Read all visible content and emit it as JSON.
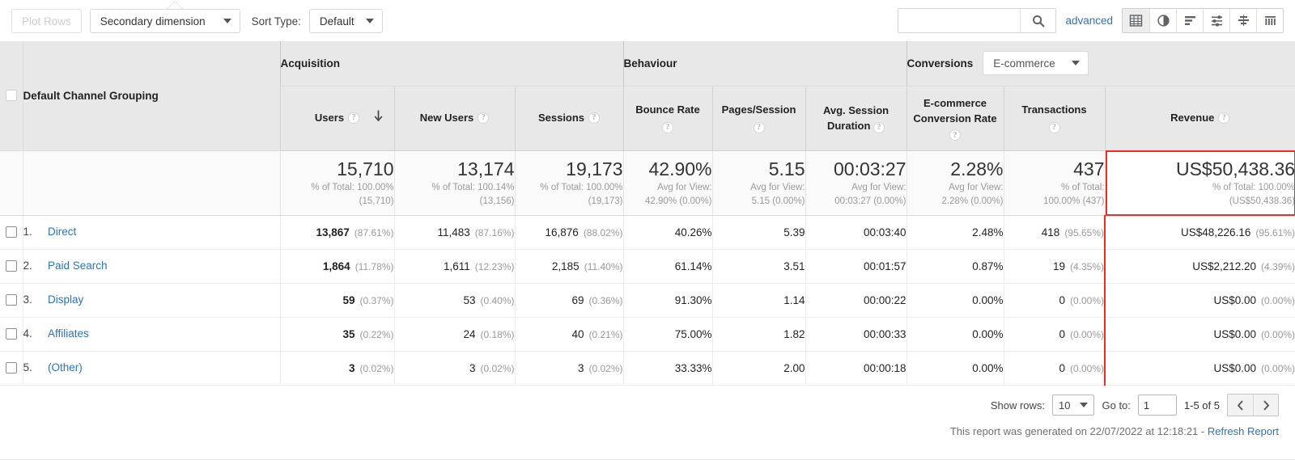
{
  "toolbar": {
    "plot_rows_label": "Plot Rows",
    "secondary_dimension_label": "Secondary dimension",
    "sort_type_label": "Sort Type:",
    "sort_type_value": "Default",
    "search_placeholder": "",
    "search_value": "",
    "search_icon": "search-icon",
    "advanced_label": "advanced",
    "view_buttons": [
      {
        "name": "table-view",
        "icon": "table-icon",
        "active": true
      },
      {
        "name": "pie-view",
        "icon": "pie-chart-icon",
        "active": false
      },
      {
        "name": "percentage-view",
        "icon": "bar-chart-icon",
        "active": false
      },
      {
        "name": "performance-view",
        "icon": "performance-icon",
        "active": false
      },
      {
        "name": "comparison-view",
        "icon": "comparison-icon",
        "active": false
      },
      {
        "name": "pivot-view",
        "icon": "pivot-icon",
        "active": false
      }
    ]
  },
  "table": {
    "dimension_header": "Default Channel Grouping",
    "groups": [
      {
        "label": "Acquisition"
      },
      {
        "label": "Behaviour"
      },
      {
        "label": "Conversions",
        "dropdown": "E-commerce"
      }
    ],
    "columns": [
      {
        "label": "Users",
        "help": "?",
        "sorted": "desc"
      },
      {
        "label": "New Users",
        "help": "?"
      },
      {
        "label": "Sessions",
        "help": "?"
      },
      {
        "label": "Bounce Rate",
        "help": "?"
      },
      {
        "label": "Pages/Session",
        "help": "?"
      },
      {
        "label": "Avg. Session Duration",
        "help": "?"
      },
      {
        "label": "E-commerce Conversion Rate",
        "help": "?"
      },
      {
        "label": "Transactions",
        "help": "?"
      },
      {
        "label": "Revenue",
        "help": "?"
      }
    ],
    "summary": [
      {
        "value": "15,710",
        "sub1": "% of Total: 100.00%",
        "sub2": "(15,710)"
      },
      {
        "value": "13,174",
        "sub1": "% of Total: 100.14%",
        "sub2": "(13,156)"
      },
      {
        "value": "19,173",
        "sub1": "% of Total: 100.00%",
        "sub2": "(19,173)"
      },
      {
        "value": "42.90%",
        "sub1": "Avg for View:",
        "sub2": "42.90% (0.00%)"
      },
      {
        "value": "5.15",
        "sub1": "Avg for View:",
        "sub2": "5.15 (0.00%)"
      },
      {
        "value": "00:03:27",
        "sub1": "Avg for View:",
        "sub2": "00:03:27 (0.00%)"
      },
      {
        "value": "2.28%",
        "sub1": "Avg for View:",
        "sub2": "2.28% (0.00%)"
      },
      {
        "value": "437",
        "sub1": "% of Total:",
        "sub2": "100.00% (437)"
      },
      {
        "value": "US$50,438.36",
        "sub1": "% of Total: 100.00%",
        "sub2": "(US$50,438.36)"
      }
    ],
    "rows": [
      {
        "index": "1.",
        "name": "Direct",
        "users": "13,867",
        "users_pct": "(87.61%)",
        "new_users": "11,483",
        "new_users_pct": "(87.16%)",
        "sessions": "16,876",
        "sessions_pct": "(88.02%)",
        "bounce_rate": "40.26%",
        "pages_session": "5.39",
        "avg_duration": "00:03:40",
        "ecom_rate": "2.48%",
        "transactions": "418",
        "transactions_pct": "(95.65%)",
        "revenue": "US$48,226.16",
        "revenue_pct": "(95.61%)"
      },
      {
        "index": "2.",
        "name": "Paid Search",
        "users": "1,864",
        "users_pct": "(11.78%)",
        "new_users": "1,611",
        "new_users_pct": "(12.23%)",
        "sessions": "2,185",
        "sessions_pct": "(11.40%)",
        "bounce_rate": "61.14%",
        "pages_session": "3.51",
        "avg_duration": "00:01:57",
        "ecom_rate": "0.87%",
        "transactions": "19",
        "transactions_pct": "(4.35%)",
        "revenue": "US$2,212.20",
        "revenue_pct": "(4.39%)"
      },
      {
        "index": "3.",
        "name": "Display",
        "users": "59",
        "users_pct": "(0.37%)",
        "new_users": "53",
        "new_users_pct": "(0.40%)",
        "sessions": "69",
        "sessions_pct": "(0.36%)",
        "bounce_rate": "91.30%",
        "pages_session": "1.14",
        "avg_duration": "00:00:22",
        "ecom_rate": "0.00%",
        "transactions": "0",
        "transactions_pct": "(0.00%)",
        "revenue": "US$0.00",
        "revenue_pct": "(0.00%)"
      },
      {
        "index": "4.",
        "name": "Affiliates",
        "users": "35",
        "users_pct": "(0.22%)",
        "new_users": "24",
        "new_users_pct": "(0.18%)",
        "sessions": "40",
        "sessions_pct": "(0.21%)",
        "bounce_rate": "75.00%",
        "pages_session": "1.82",
        "avg_duration": "00:00:33",
        "ecom_rate": "0.00%",
        "transactions": "0",
        "transactions_pct": "(0.00%)",
        "revenue": "US$0.00",
        "revenue_pct": "(0.00%)"
      },
      {
        "index": "5.",
        "name": "(Other)",
        "users": "3",
        "users_pct": "(0.02%)",
        "new_users": "3",
        "new_users_pct": "(0.02%)",
        "sessions": "3",
        "sessions_pct": "(0.02%)",
        "bounce_rate": "33.33%",
        "pages_session": "2.00",
        "avg_duration": "00:00:18",
        "ecom_rate": "0.00%",
        "transactions": "0",
        "transactions_pct": "(0.00%)",
        "revenue": "US$0.00",
        "revenue_pct": "(0.00%)"
      }
    ],
    "highlight_color": "#ef2b23"
  },
  "footer": {
    "show_rows_label": "Show rows:",
    "show_rows_value": "10",
    "go_to_label": "Go to:",
    "go_to_value": "1",
    "range_label": "1-5 of 5",
    "prev_icon": "chevron-left-icon",
    "next_icon": "chevron-right-icon",
    "generated_text": "This report was generated on 22/07/2022 at 12:18:21 - ",
    "refresh_label": "Refresh Report"
  }
}
